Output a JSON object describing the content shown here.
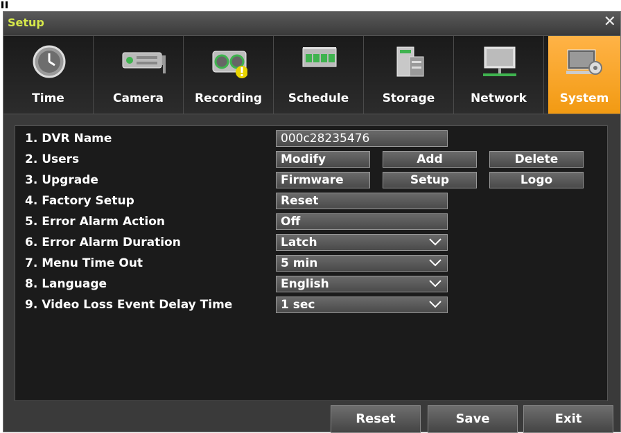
{
  "window": {
    "title": "Setup"
  },
  "tabs": [
    {
      "label": "Time",
      "icon": "clock-icon"
    },
    {
      "label": "Camera",
      "icon": "camera-icon"
    },
    {
      "label": "Recording",
      "icon": "recording-icon"
    },
    {
      "label": "Schedule",
      "icon": "schedule-icon"
    },
    {
      "label": "Storage",
      "icon": "storage-icon"
    },
    {
      "label": "Network",
      "icon": "network-icon"
    },
    {
      "label": "System",
      "icon": "system-icon",
      "active": true
    }
  ],
  "settings": {
    "dvr_name": {
      "label": "1. DVR Name",
      "value": "000c28235476"
    },
    "users": {
      "label": "2. Users",
      "modify": "Modify",
      "add": "Add",
      "delete": "Delete"
    },
    "upgrade": {
      "label": "3. Upgrade",
      "firmware": "Firmware",
      "setup": "Setup",
      "logo": "Logo"
    },
    "factory_setup": {
      "label": "4. Factory Setup",
      "value": "Reset"
    },
    "error_alarm_action": {
      "label": "5. Error Alarm Action",
      "value": "Off"
    },
    "error_alarm_duration": {
      "label": "6. Error Alarm Duration",
      "value": "Latch"
    },
    "menu_time_out": {
      "label": "7. Menu Time Out",
      "value": "5 min"
    },
    "language": {
      "label": "8. Language",
      "value": "English"
    },
    "video_loss_delay": {
      "label": "9. Video Loss Event Delay Time",
      "value": "1 sec"
    }
  },
  "footer": {
    "reset": "Reset",
    "save": "Save",
    "exit": "Exit"
  },
  "colors": {
    "active_tab": "#f29a12",
    "title_text": "#d6e84a"
  }
}
